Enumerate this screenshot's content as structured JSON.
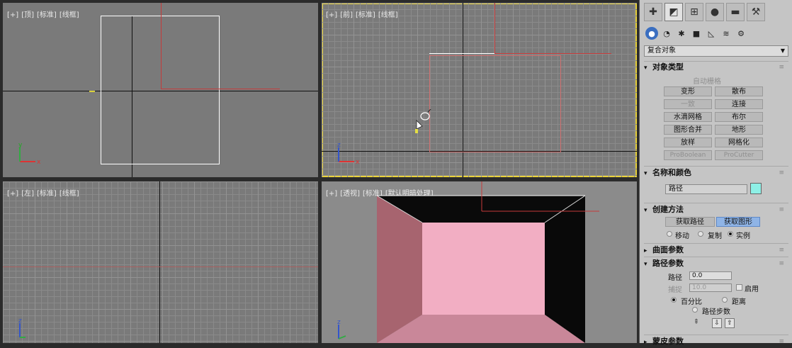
{
  "viewports": {
    "top": {
      "labels": [
        "[+]",
        "[顶]",
        "[标准]",
        "[线框]"
      ]
    },
    "front": {
      "labels": [
        "[+]",
        "[前]",
        "[标准]",
        "[线框]"
      ]
    },
    "left": {
      "labels": [
        "[+]",
        "[左]",
        "[标准]",
        "[线框]"
      ]
    },
    "persp": {
      "labels": [
        "[+]",
        "[透视]",
        "[标准]",
        "[默认明暗处理]"
      ]
    }
  },
  "axis": {
    "x": "x",
    "y": "y",
    "z": "z"
  },
  "panel": {
    "tab_icons": [
      "create-icon",
      "modify-icon",
      "hierarchy-icon",
      "motion-icon",
      "display-icon",
      "utilities-icon"
    ],
    "sub_icons": [
      "geometry-icon",
      "shapes-icon",
      "lights-icon",
      "cameras-icon",
      "helpers-icon",
      "spacewarps-icon",
      "systems-icon"
    ],
    "category": "复合对象",
    "object_type": {
      "title": "对象类型",
      "autogrid": "自动栅格",
      "buttons": [
        {
          "label": "变形",
          "disabled": false
        },
        {
          "label": "散布",
          "disabled": false
        },
        {
          "label": "一致",
          "disabled": true
        },
        {
          "label": "连接",
          "disabled": false
        },
        {
          "label": "水滴网格",
          "disabled": false
        },
        {
          "label": "布尔",
          "disabled": false
        },
        {
          "label": "图形合并",
          "disabled": false
        },
        {
          "label": "地形",
          "disabled": false
        },
        {
          "label": "放样",
          "disabled": false
        },
        {
          "label": "网格化",
          "disabled": false
        },
        {
          "label": "ProBoolean",
          "disabled": true
        },
        {
          "label": "ProCutter",
          "disabled": true
        }
      ]
    },
    "name_color": {
      "title": "名称和颜色",
      "name": "路径",
      "swatch": "#8ef0e6"
    },
    "creation": {
      "title": "创建方法",
      "get_path": "获取路径",
      "get_shape": "获取图形",
      "move": "移动",
      "copy": "复制",
      "instance": "实例"
    },
    "surface": {
      "title": "曲面参数"
    },
    "path_params": {
      "title": "路径参数",
      "path_label": "路径",
      "path_value": "0.0",
      "snap_label": "捕捉",
      "snap_value": "10.0",
      "enable": "启用",
      "percent": "百分比",
      "distance": "距离",
      "path_steps": "路径步数"
    },
    "skin": {
      "title": "蒙皮参数"
    }
  }
}
